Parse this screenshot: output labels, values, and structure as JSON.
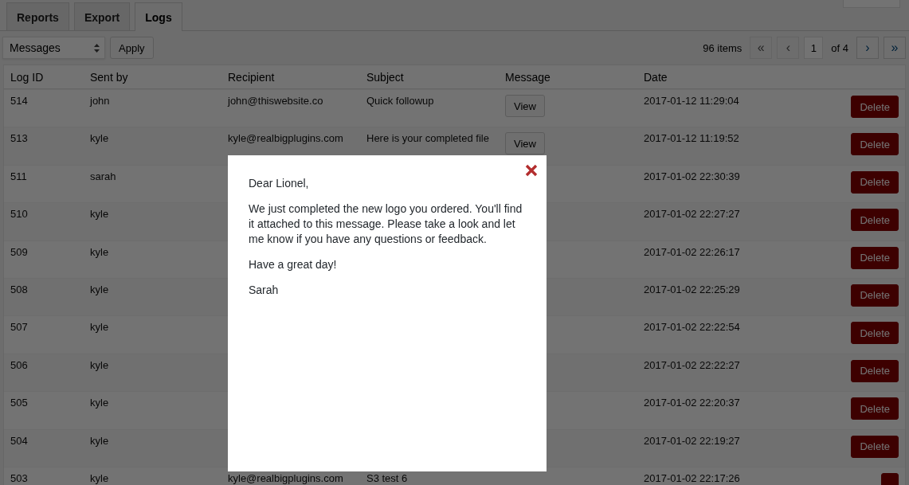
{
  "tabs": [
    {
      "label": "Reports",
      "selected": false
    },
    {
      "label": "Export",
      "selected": false
    },
    {
      "label": "Logs",
      "selected": true
    }
  ],
  "toolbar": {
    "filter": "Messages",
    "apply": "Apply"
  },
  "pagination": {
    "count": "96 items",
    "first": {
      "label": "«",
      "disabled": true
    },
    "prev": {
      "label": "‹",
      "disabled": true
    },
    "page": "1",
    "total": "of 4",
    "next": {
      "label": "›",
      "disabled": false
    },
    "last": {
      "label": "»",
      "disabled": false
    }
  },
  "table": {
    "columns": [
      "Log ID",
      "Sent by",
      "Recipient",
      "Subject",
      "Message",
      "Date"
    ],
    "rows": [
      {
        "id": "514",
        "sent_by": "john",
        "recipient": "john@thiswebsite.co",
        "subject": "Quick followup",
        "message": "View",
        "date": "2017-01-12 11:29:04",
        "action": "Delete"
      },
      {
        "id": "513",
        "sent_by": "kyle",
        "recipient": "kyle@realbigplugins.com",
        "subject": "Here is your completed file",
        "message": "View",
        "date": "2017-01-12 11:19:52",
        "action": "Delete"
      },
      {
        "id": "511",
        "sent_by": "sarah",
        "date": "2017-01-02 22:30:39",
        "action": "Delete"
      },
      {
        "id": "510",
        "sent_by": "kyle",
        "date": "2017-01-02 22:27:27",
        "action": "Delete"
      },
      {
        "id": "509",
        "sent_by": "kyle",
        "date": "2017-01-02 22:26:17",
        "action": "Delete"
      },
      {
        "id": "508",
        "sent_by": "kyle",
        "date": "2017-01-02 22:25:29",
        "action": "Delete"
      },
      {
        "id": "507",
        "sent_by": "kyle",
        "date": "2017-01-02 22:22:54",
        "action": "Delete"
      },
      {
        "id": "506",
        "sent_by": "kyle",
        "date": "2017-01-02 22:22:27",
        "action": "Delete"
      },
      {
        "id": "505",
        "sent_by": "kyle",
        "date": "2017-01-02 22:20:37",
        "action": "Delete"
      },
      {
        "id": "504",
        "sent_by": "kyle",
        "date": "2017-01-02 22:19:27",
        "action": "Delete"
      },
      {
        "id": "503",
        "sent_by": "kyle",
        "recipient": "kyle@realbigplugins.com",
        "subject": "S3 test 6",
        "date": "2017-01-02 22:17:26"
      }
    ]
  },
  "modal": {
    "paragraphs": [
      "Dear Lionel,",
      "We just completed the new logo you ordered. You'll find it attached to this message. Please take a look and let me know if you have any questions or feedback.",
      "Have a great day!",
      "Sarah"
    ]
  }
}
